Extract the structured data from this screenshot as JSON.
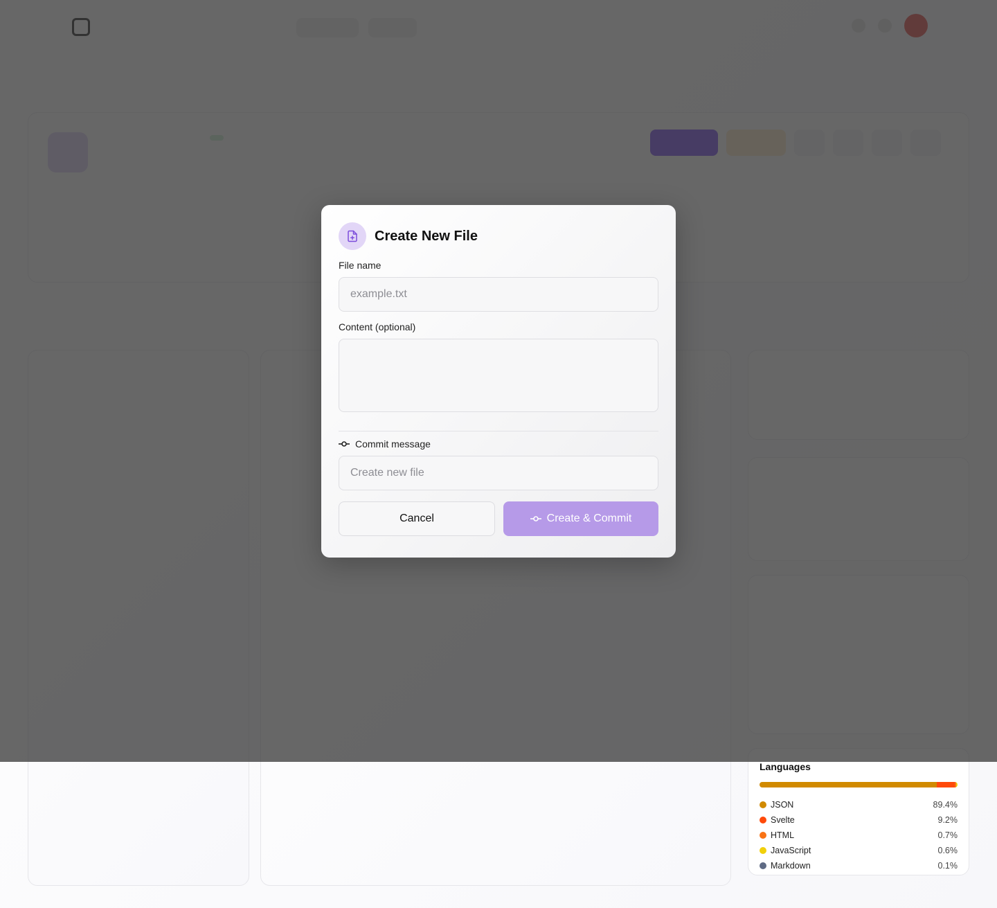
{
  "modal": {
    "title": "Create New File",
    "file_name_label": "File name",
    "file_name_placeholder": "example.txt",
    "content_label": "Content (optional)",
    "commit_label": "Commit message",
    "commit_placeholder": "Create new file",
    "cancel_label": "Cancel",
    "create_label": "Create & Commit",
    "accent_color": "#b69ae8",
    "icon": "file-plus-icon"
  },
  "languages": {
    "title": "Languages",
    "items": [
      {
        "name": "JSON",
        "percent": "89.4%",
        "value": 89.4,
        "color": "#d18a00"
      },
      {
        "name": "Svelte",
        "percent": "9.2%",
        "value": 9.2,
        "color": "#ff4a0a"
      },
      {
        "name": "HTML",
        "percent": "0.7%",
        "value": 0.7,
        "color": "#f97316"
      },
      {
        "name": "JavaScript",
        "percent": "0.6%",
        "value": 0.6,
        "color": "#f1d00a"
      },
      {
        "name": "Markdown",
        "percent": "0.1%",
        "value": 0.1,
        "color": "#5f6b84"
      }
    ]
  }
}
